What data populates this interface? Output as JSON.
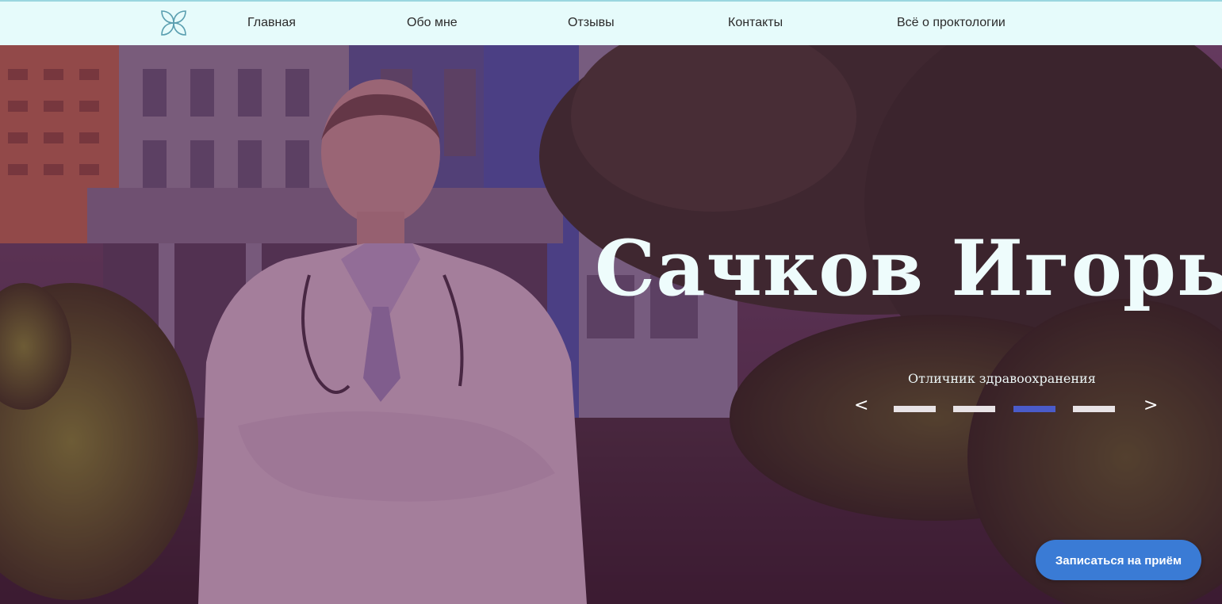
{
  "nav": {
    "items": [
      {
        "label": "Главная"
      },
      {
        "label": "Обо мне"
      },
      {
        "label": "Отзывы"
      },
      {
        "label": "Контакты"
      },
      {
        "label": "Всё о проктологии"
      }
    ]
  },
  "hero": {
    "title": "Сачков Игорь",
    "subtitle": "Отличник здравоохранения",
    "prev_label": "<",
    "next_label": ">",
    "slides_total": 4,
    "active_slide": 3,
    "cta_label": "Записаться на приём"
  },
  "colors": {
    "topbar_bg": "#e6fbfb",
    "cta_bg": "#3a7bd5",
    "active_dot": "#4a5bc9",
    "hero_tint": "#5c1c48"
  },
  "icons": {
    "logo": "four-petal-flower-icon"
  }
}
